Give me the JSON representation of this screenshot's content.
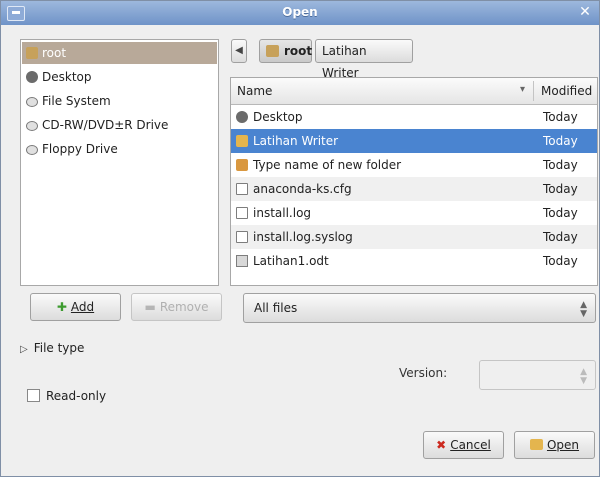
{
  "window": {
    "title": "Open"
  },
  "places": [
    {
      "label": "root",
      "icon": "home-folder-icon",
      "selected": true
    },
    {
      "label": "Desktop",
      "icon": "desktop-icon"
    },
    {
      "label": "File System",
      "icon": "drive-icon"
    },
    {
      "label": "CD-RW/DVD±R Drive",
      "icon": "drive-icon"
    },
    {
      "label": "Floppy Drive",
      "icon": "drive-icon"
    }
  ],
  "buttons": {
    "add": "Add",
    "remove": "Remove",
    "cancel": "Cancel",
    "open": "Open"
  },
  "path_bar": {
    "crumbs": [
      "root",
      "Latihan Writer"
    ]
  },
  "file_list": {
    "columns": {
      "name": "Name",
      "modified": "Modified"
    },
    "rows": [
      {
        "name": "Desktop",
        "modified": "Today",
        "icon": "desktop-icon"
      },
      {
        "name": "Latihan Writer",
        "modified": "Today",
        "icon": "folder-icon",
        "selected": true
      },
      {
        "name": "Type name of new folder",
        "modified": "Today",
        "icon": "folder-edit-icon"
      },
      {
        "name": "anaconda-ks.cfg",
        "modified": "Today",
        "icon": "document-icon"
      },
      {
        "name": "install.log",
        "modified": "Today",
        "icon": "document-icon"
      },
      {
        "name": "install.log.syslog",
        "modified": "Today",
        "icon": "document-icon"
      },
      {
        "name": "Latihan1.odt",
        "modified": "Today",
        "icon": "odt-document-icon"
      }
    ]
  },
  "filter": {
    "selected": "All files"
  },
  "file_type": {
    "label": "File type"
  },
  "version": {
    "label": "Version:",
    "value": ""
  },
  "read_only": {
    "label": "Read-only",
    "checked": false
  },
  "colors": {
    "selection": "#4a84d0",
    "place_selection": "#b8a999",
    "titlebar": "#7c9ccc"
  }
}
